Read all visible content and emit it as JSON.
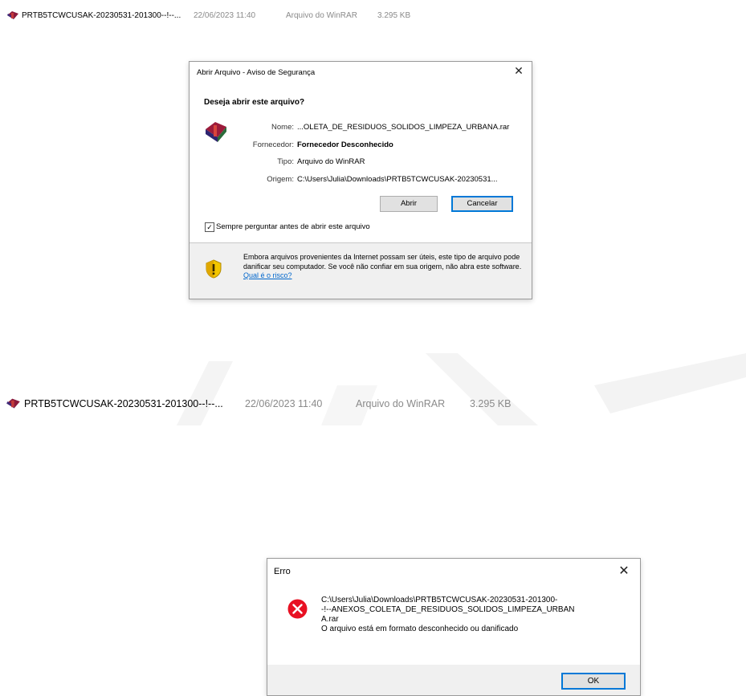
{
  "file_rows": [
    {
      "icon": "winrar-icon",
      "name": "PRTB5TCWCUSAK-20230531-201300--!--...",
      "date": "22/06/2023 11:40",
      "type": "Arquivo do WinRAR",
      "size": "3.295 KB"
    },
    {
      "icon": "winrar-icon",
      "name": "PRTB5TCWCUSAK-20230531-201300--!--...",
      "date": "22/06/2023 11:40",
      "type": "Arquivo do WinRAR",
      "size": "3.295 KB"
    }
  ],
  "security_dialog": {
    "title": "Abrir Arquivo - Aviso de Segurança",
    "close_icon": "close-icon",
    "question": "Deseja abrir este arquivo?",
    "fields": [
      {
        "label": "Nome:",
        "value": "...OLETA_DE_RESIDUOS_SOLIDOS_LIMPEZA_URBANA.rar"
      },
      {
        "label": "Fornecedor:",
        "value": "Fornecedor Desconhecido"
      },
      {
        "label": "Tipo:",
        "value": "Arquivo do WinRAR"
      },
      {
        "label": "Origem:",
        "value": "C:\\Users\\Julia\\Downloads\\PRTB5TCWCUSAK-20230531..."
      }
    ],
    "open_button": "Abrir",
    "cancel_button": "Cancelar",
    "checkbox_label": "Sempre perguntar antes de abrir este arquivo",
    "checkbox_checked": true,
    "warning_text": "Embora arquivos provenientes da Internet possam ser úteis, este tipo de arquivo pode danificar seu computador. Se você não confiar em sua origem, não abra este software.",
    "risk_link": "Qual é o risco?"
  },
  "error_dialog": {
    "title": "Erro",
    "close_icon": "close-icon",
    "path_line1": "C:\\Users\\Julia\\Downloads\\PRTB5TCWCUSAK-20230531-201300-",
    "path_line2": "-!--ANEXOS_COLETA_DE_RESIDUOS_SOLIDOS_LIMPEZA_URBAN",
    "path_line3": "A.rar",
    "message": "O arquivo está em formato desconhecido ou danificado",
    "ok_button": "OK"
  },
  "colors": {
    "accent": "#0078d7",
    "error_red": "#e81123",
    "link": "#0066cc",
    "shield_yellow": "#f3c600"
  }
}
